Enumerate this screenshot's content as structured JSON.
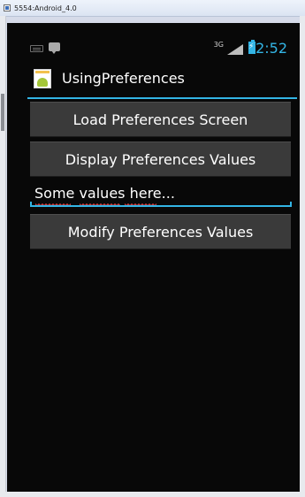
{
  "window": {
    "title": "5554:Android_4.0"
  },
  "status_bar": {
    "network_type": "3G",
    "time": "2:52",
    "icons": [
      "keyboard-icon",
      "message-icon",
      "signal-icon",
      "battery-charging-icon"
    ]
  },
  "action_bar": {
    "app_title": "UsingPreferences",
    "app_icon": "app-launcher-icon"
  },
  "buttons": {
    "load": "Load Preferences Screen",
    "display": "Display Preferences Values",
    "modify": "Modify Preferences Values"
  },
  "text_field": {
    "value": "Some values here..."
  },
  "colors": {
    "accent": "#33b5e5",
    "background": "#080808",
    "button": "#3a3a3a",
    "text": "#ffffff"
  }
}
